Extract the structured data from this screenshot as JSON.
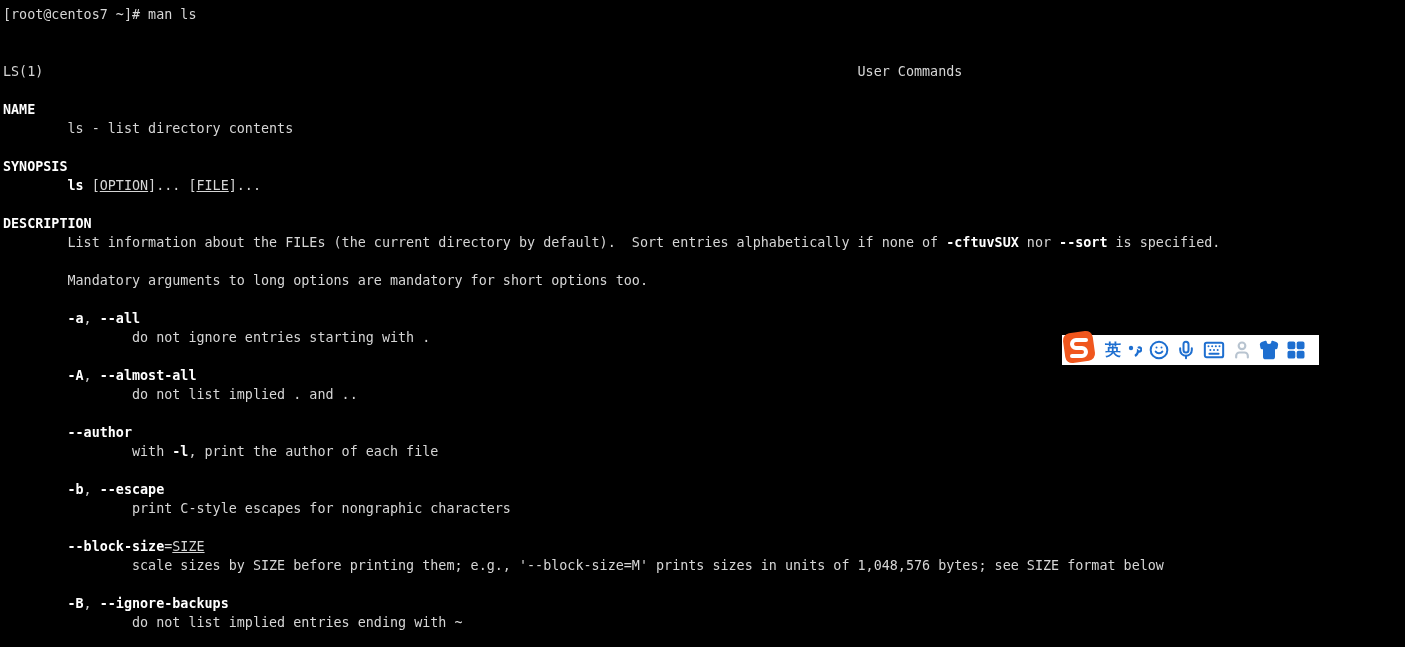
{
  "prompt": "[root@centos7 ~]# man ls",
  "header": {
    "left": "LS(1)",
    "center": "User Commands"
  },
  "sections": [
    {
      "title": "NAME",
      "items": [
        {
          "kind": "para",
          "segments": [
            {
              "text": "ls - list directory contents",
              "bold": false,
              "underline": false
            }
          ]
        }
      ]
    },
    {
      "title": "SYNOPSIS",
      "items": [
        {
          "kind": "para",
          "segments": [
            {
              "text": "ls",
              "bold": true,
              "underline": false
            },
            {
              "text": " [",
              "bold": false,
              "underline": false
            },
            {
              "text": "OPTION",
              "bold": false,
              "underline": true
            },
            {
              "text": "]... [",
              "bold": false,
              "underline": false
            },
            {
              "text": "FILE",
              "bold": false,
              "underline": true
            },
            {
              "text": "]...",
              "bold": false,
              "underline": false
            }
          ]
        }
      ]
    },
    {
      "title": "DESCRIPTION",
      "items": [
        {
          "kind": "para",
          "segments": [
            {
              "text": "List information about the FILEs (the current directory by default).  Sort entries alphabetically if none of ",
              "bold": false,
              "underline": false
            },
            {
              "text": "-cftuvSUX",
              "bold": true,
              "underline": false
            },
            {
              "text": " nor ",
              "bold": false,
              "underline": false
            },
            {
              "text": "--sort",
              "bold": true,
              "underline": false
            },
            {
              "text": " is specified.",
              "bold": false,
              "underline": false
            }
          ]
        },
        {
          "kind": "para",
          "segments": [
            {
              "text": "Mandatory arguments to long options are mandatory for short options too.",
              "bold": false,
              "underline": false
            }
          ]
        },
        {
          "kind": "option",
          "segments": [
            {
              "text": "-a",
              "bold": true,
              "underline": false
            },
            {
              "text": ", ",
              "bold": false,
              "underline": false
            },
            {
              "text": "--all",
              "bold": true,
              "underline": false
            }
          ],
          "description": [
            {
              "text": "do not ignore entries starting with .",
              "bold": false,
              "underline": false
            }
          ]
        },
        {
          "kind": "option",
          "segments": [
            {
              "text": "-A",
              "bold": true,
              "underline": false
            },
            {
              "text": ", ",
              "bold": false,
              "underline": false
            },
            {
              "text": "--almost-all",
              "bold": true,
              "underline": false
            }
          ],
          "description": [
            {
              "text": "do not list implied . and ..",
              "bold": false,
              "underline": false
            }
          ]
        },
        {
          "kind": "option",
          "segments": [
            {
              "text": "--author",
              "bold": true,
              "underline": false
            }
          ],
          "description": [
            {
              "text": "with ",
              "bold": false,
              "underline": false
            },
            {
              "text": "-l",
              "bold": true,
              "underline": false
            },
            {
              "text": ", print the author of each file",
              "bold": false,
              "underline": false
            }
          ]
        },
        {
          "kind": "option",
          "segments": [
            {
              "text": "-b",
              "bold": true,
              "underline": false
            },
            {
              "text": ", ",
              "bold": false,
              "underline": false
            },
            {
              "text": "--escape",
              "bold": true,
              "underline": false
            }
          ],
          "description": [
            {
              "text": "print C-style escapes for nongraphic characters",
              "bold": false,
              "underline": false
            }
          ]
        },
        {
          "kind": "option",
          "segments": [
            {
              "text": "--block-size",
              "bold": true,
              "underline": false
            },
            {
              "text": "=",
              "bold": false,
              "underline": false
            },
            {
              "text": "SIZE",
              "bold": false,
              "underline": true
            }
          ],
          "description": [
            {
              "text": "scale sizes by SIZE before printing them; e.g., '--block-size=M' prints sizes in units of 1,048,576 bytes; see SIZE format below",
              "bold": false,
              "underline": false
            }
          ]
        },
        {
          "kind": "option",
          "segments": [
            {
              "text": "-B",
              "bold": true,
              "underline": false
            },
            {
              "text": ", ",
              "bold": false,
              "underline": false
            },
            {
              "text": "--ignore-backups",
              "bold": true,
              "underline": false
            }
          ],
          "description": [
            {
              "text": "do not list implied entries ending with ~",
              "bold": false,
              "underline": false
            }
          ]
        }
      ]
    }
  ],
  "ime_toolbar": {
    "language": "英"
  }
}
